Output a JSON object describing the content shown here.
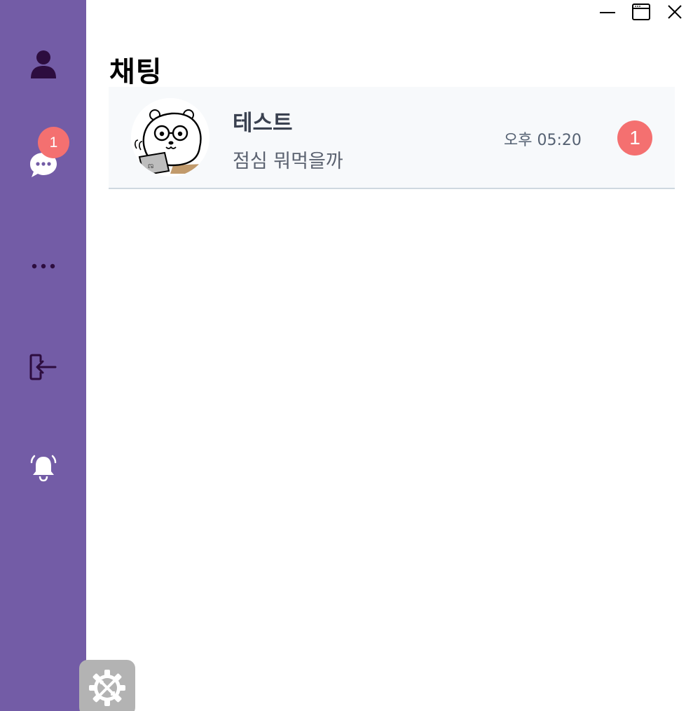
{
  "window": {
    "minimize_icon": "minimize-icon",
    "maximize_icon": "maximize-icon",
    "close_icon": "close-icon"
  },
  "sidebar": {
    "background": "#735ca6",
    "items": [
      {
        "id": "profile",
        "icon": "user-icon"
      },
      {
        "id": "chat",
        "icon": "chat-bubble-icon",
        "badge": "1"
      },
      {
        "id": "more",
        "icon": "more-dots-icon"
      },
      {
        "id": "logout",
        "icon": "logout-icon"
      },
      {
        "id": "notifications",
        "icon": "bell-icon"
      }
    ],
    "settings": {
      "icon": "gear-tools-icon"
    }
  },
  "page": {
    "title": "채팅"
  },
  "chats": [
    {
      "name": "테스트",
      "preview": "점심 뭐먹을까",
      "time": "오후 05:20",
      "unread": "1",
      "avatar": "bear-with-laptop-avatar"
    }
  ],
  "colors": {
    "accent": "#735ca6",
    "badge": "#f47070",
    "row_background": "#f7f9fb",
    "row_border": "#cfd8e0"
  }
}
